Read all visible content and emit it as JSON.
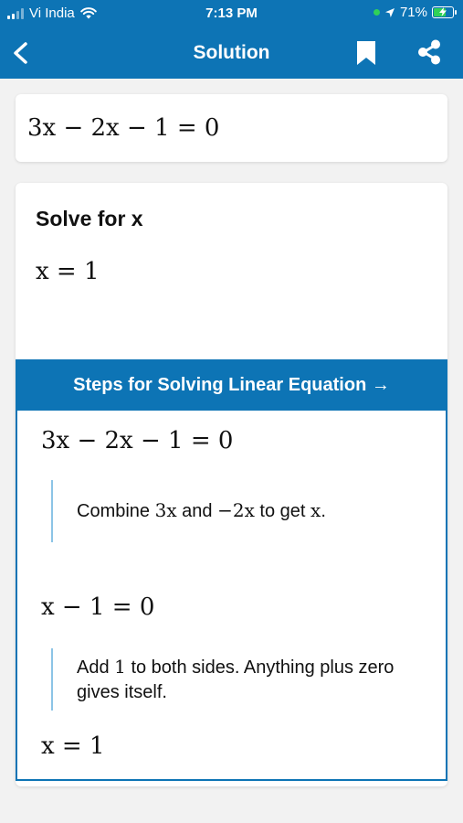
{
  "status_bar": {
    "carrier": "Vi India",
    "time": "7:13 PM",
    "battery_percent": "71%",
    "battery_level": 0.71,
    "signal_bars_filled": 2
  },
  "nav": {
    "title": "Solution",
    "back_icon": "chevron-left-icon",
    "bookmark_icon": "bookmark-icon",
    "share_icon": "share-icon"
  },
  "problem": {
    "equation": "3x − 2x − 1 = 0"
  },
  "solution": {
    "heading": "Solve for x",
    "result": "x = 1"
  },
  "steps": {
    "header": "Steps for Solving Linear Equation →",
    "items": [
      {
        "equation": "3x − 2x − 1 = 0",
        "note_prefix": "Combine ",
        "note_term1": "3x",
        "note_mid": " and ",
        "note_term2": "−2x",
        "note_mid2": " to get ",
        "note_term3": "x",
        "note_suffix": "."
      },
      {
        "equation": "x − 1 = 0",
        "note_prefix": "Add ",
        "note_term1": "1",
        "note_suffix": " to both sides. Anything plus zero gives itself."
      },
      {
        "equation": "x = 1"
      }
    ]
  },
  "colors": {
    "brand_blue": "#0d74b5",
    "step_rule": "#8cc4e6",
    "background": "#f2f2f2"
  }
}
